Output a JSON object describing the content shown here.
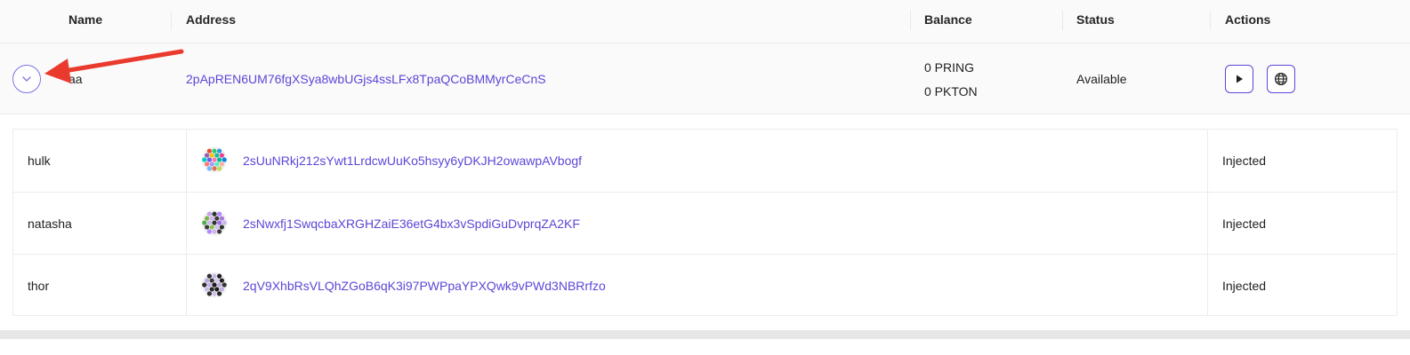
{
  "table": {
    "columns": [
      "Name",
      "Address",
      "Balance",
      "Status",
      "Actions"
    ]
  },
  "account": {
    "name": "aa",
    "address": "2pApREN6UM76fgXSya8wbUGjs4ssLFx8TpaQCoBMMyrCeCnS",
    "balances": [
      "0 PRING",
      "0 PKTON"
    ],
    "status": "Available",
    "actions": [
      "play-icon",
      "globe-icon"
    ],
    "expand_icon": "chevron-down-icon"
  },
  "signatories": [
    {
      "name": "hulk",
      "address": "2sUuNRkj212sYwt1LrdcwUuKo5hsyy6yDKJH2owawpAVbogf",
      "status": "Injected",
      "icon_colors": [
        "#e74c3c",
        "#2ecc71",
        "#3498db",
        "#9b59b6",
        "#f1c40f",
        "#1abc9c",
        "#e84393",
        "#00cec9",
        "#6c5ce7",
        "#fd79a8",
        "#00b894",
        "#0984e3",
        "#ff7675",
        "#a29bfe",
        "#55efc4",
        "#fab1a0",
        "#74b9ff",
        "#e17055",
        "#badc58"
      ]
    },
    {
      "name": "natasha",
      "address": "2sNwxfj1SwqcbaXRGHZaiE36etG4bx3vSpdiGuDvprqZA2KF",
      "status": "Injected",
      "icon_colors": [
        "#c8a2e8",
        "#2d3436",
        "#b388ff",
        "#7cb342",
        "#d1b3f0",
        "#3d3d3d",
        "#a67bd8",
        "#4caf50",
        "#cfb5ef",
        "#2d3436",
        "#9d6fe0",
        "#cdb4f0",
        "#3d3d3d",
        "#8bc34a",
        "#d3bff2",
        "#2d3436",
        "#b388ff",
        "#cfb5ef",
        "#3d3d3d"
      ]
    },
    {
      "name": "thor",
      "address": "2qV9XhbRsVLQhZGoB6qK3i97PWPpaYPXQwk9vPWd3NBRrfzo",
      "status": "Injected",
      "icon_colors": [
        "#2d2d2d",
        "#c9b8e6",
        "#1e1e1e",
        "#b9a7dc",
        "#3b3b3b",
        "#d4c6ee",
        "#222222",
        "#2f2f2f",
        "#c4b0e8",
        "#1a1a1a",
        "#bda9e0",
        "#353535",
        "#cbbbe9",
        "#2a2a2a",
        "#1f1f1f",
        "#c0afe2",
        "#303030",
        "#d0c0ec",
        "#262626"
      ]
    }
  ],
  "colors": {
    "accent": "#5a47d6",
    "annotation_arrow": "#ea3a2d"
  }
}
